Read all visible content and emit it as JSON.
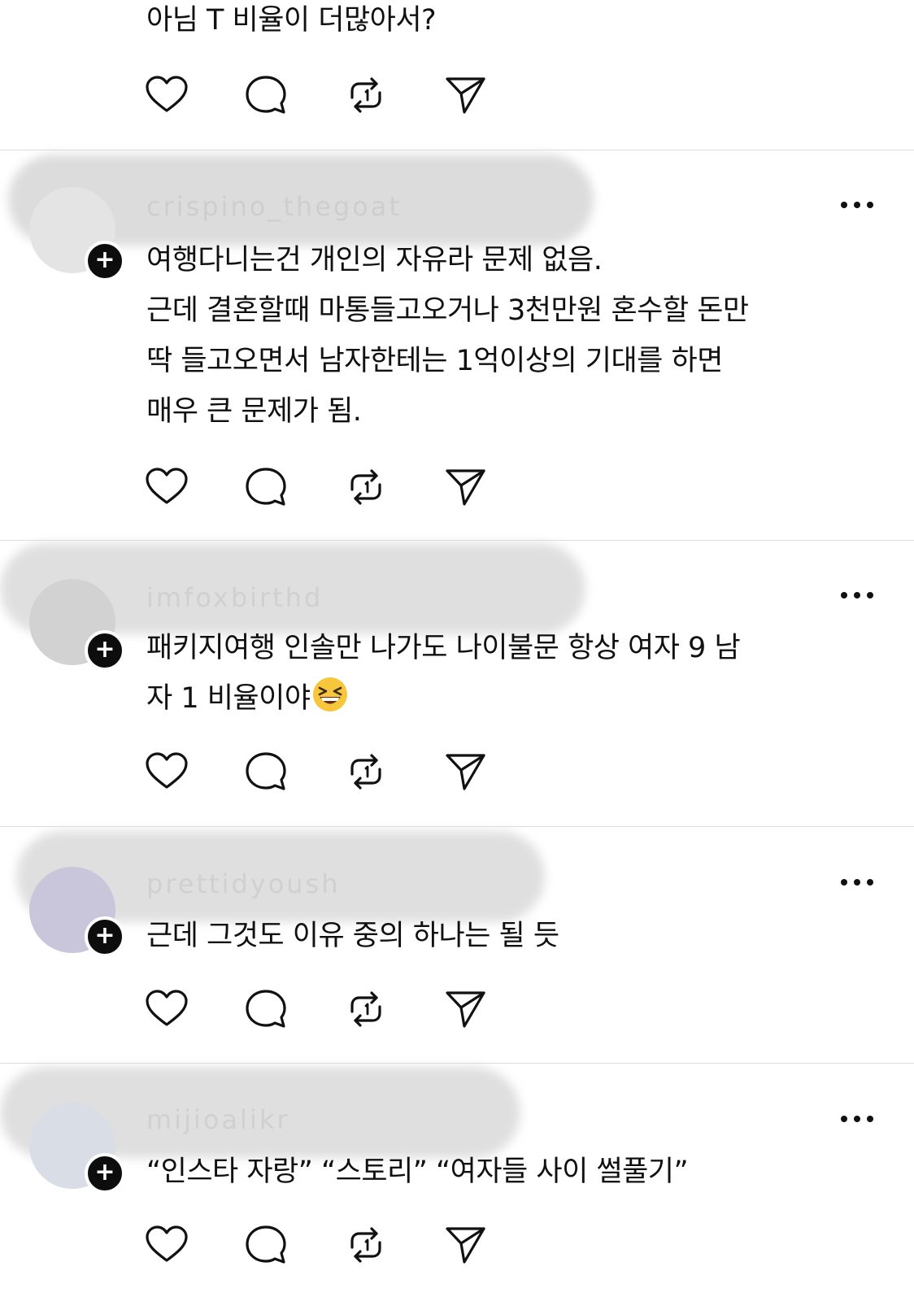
{
  "posts": [
    {
      "username": "",
      "text": "아님 T 비율이 더많아서?"
    },
    {
      "username": "crispino_thegoat",
      "text": "여행다니는건 개인의 자유라 문제 없음.\n근데 결혼할때 마통들고오거나 3천만원 혼수할 돈만\n딱 들고오면서 남자한테는 1억이상의 기대를 하면\n매우 큰 문제가 됨."
    },
    {
      "username": "imfoxbirthd",
      "text": "패키지여행 인솔만 나가도 나이불문 항상 여자 9 남\n자 1 비율이야"
    },
    {
      "username": "prettidyoush",
      "text": "근데 그것도 이유 중의 하나는 될 듯"
    },
    {
      "username": "mijioalikr",
      "text": "“인스타 자랑” “스토리” “여자들 사이 썰풀기”"
    }
  ],
  "icons": {
    "like": "heart-icon",
    "reply": "comment-bubble-icon",
    "repost": "repost-icon",
    "share": "send-icon",
    "more": "more-dots-icon",
    "follow": "plus-icon",
    "emoji": "grinning-squinting-face"
  },
  "follow_symbol": "+",
  "colors": {
    "text": "#101010",
    "icon": "#111111",
    "divider": "#dcdcdc",
    "background": "#ffffff"
  }
}
